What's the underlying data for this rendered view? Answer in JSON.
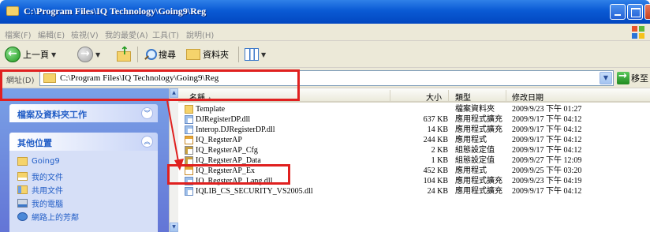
{
  "window": {
    "title": "C:\\Program Files\\IQ Technology\\Going9\\Reg"
  },
  "menu": {
    "items": [
      "檔案(F)",
      "編輯(E)",
      "檢視(V)",
      "我的最愛(A)",
      "工具(T)",
      "說明(H)"
    ]
  },
  "toolbar": {
    "back_label": "上一頁",
    "search_label": "搜尋",
    "folders_label": "資料夾"
  },
  "address": {
    "label": "網址(D)",
    "path": "C:\\Program Files\\IQ Technology\\Going9\\Reg",
    "go_label": "移至"
  },
  "left_pane": {
    "file_tasks_title": "檔案及資料夾工作",
    "other_places_title": "其他位置",
    "places": [
      {
        "label": "Going9",
        "icon": "folder-icon"
      },
      {
        "label": "我的文件",
        "icon": "my-documents-icon"
      },
      {
        "label": "共用文件",
        "icon": "shared-documents-icon"
      },
      {
        "label": "我的電腦",
        "icon": "my-computer-icon"
      },
      {
        "label": "網路上的芳鄰",
        "icon": "network-places-icon"
      }
    ]
  },
  "columns": {
    "name": "名稱",
    "size": "大小",
    "type": "類型",
    "modified": "修改日期"
  },
  "files": [
    {
      "name": "Template",
      "size": "",
      "type": "檔案資料夾",
      "modified": "2009/9/23 下午 01:27",
      "icon": "folder-icon"
    },
    {
      "name": "DJRegisterDP.dll",
      "size": "637 KB",
      "type": "應用程式擴充",
      "modified": "2009/9/17 下午 04:12",
      "icon": "dll-file-icon"
    },
    {
      "name": "Interop.DJRegisterDP.dll",
      "size": "14 KB",
      "type": "應用程式擴充",
      "modified": "2009/9/17 下午 04:12",
      "icon": "dll-file-icon"
    },
    {
      "name": "IQ_RegsterAP",
      "size": "244 KB",
      "type": "應用程式",
      "modified": "2009/9/17 下午 04:12",
      "icon": "exe-file-icon"
    },
    {
      "name": "IQ_RegsterAP_Cfg",
      "size": "2 KB",
      "type": "組態設定值",
      "modified": "2009/9/17 下午 04:12",
      "icon": "config-file-icon"
    },
    {
      "name": "IQ_RegsterAP_Data",
      "size": "1 KB",
      "type": "組態設定值",
      "modified": "2009/9/27 下午 12:09",
      "icon": "config-file-icon"
    },
    {
      "name": "IQ_RegsterAP_Ex",
      "size": "452 KB",
      "type": "應用程式",
      "modified": "2009/9/25 下午 03:20",
      "icon": "exe-file-icon"
    },
    {
      "name": "IQ_RegsterAP_Lang.dll",
      "size": "104 KB",
      "type": "應用程式擴充",
      "modified": "2009/9/23 下午 04:19",
      "icon": "dll-file-icon"
    },
    {
      "name": "IQLIB_CS_SECURITY_VS2005.dll",
      "size": "24 KB",
      "type": "應用程式擴充",
      "modified": "2009/9/17 下午 04:12",
      "icon": "dll-file-icon"
    }
  ],
  "annotation": {
    "color": "#e0201f"
  }
}
